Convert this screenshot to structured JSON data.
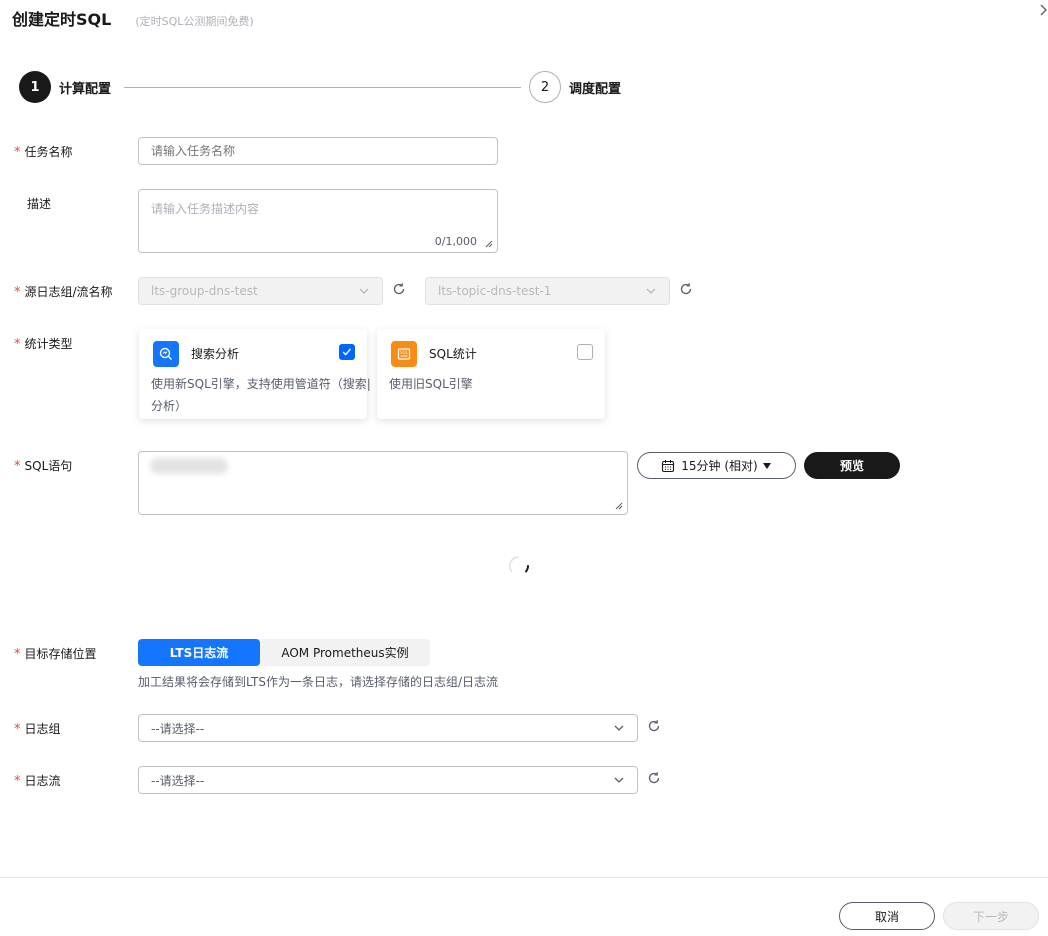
{
  "header": {
    "title": "创建定时SQL",
    "subtitle": "(定时SQL公测期间免费)"
  },
  "steps": [
    {
      "number": "1",
      "label": "计算配置",
      "active": true
    },
    {
      "number": "2",
      "label": "调度配置",
      "active": false
    }
  ],
  "form": {
    "task_name": {
      "label": "任务名称",
      "placeholder": "请输入任务名称",
      "value": ""
    },
    "description": {
      "label": "描述",
      "placeholder": "请输入任务描述内容",
      "counter": "0/1,000"
    },
    "source": {
      "label": "源日志组/流名称",
      "group_value": "lts-group-dns-test",
      "stream_value": "lts-topic-dns-test-1"
    },
    "stat_type": {
      "label": "统计类型",
      "options": [
        {
          "icon": "search-analysis-icon",
          "title": "搜索分析",
          "desc": "使用新SQL引擎，支持使用管道符（搜索|分析）",
          "checked": true,
          "icon_color": "#1476ff"
        },
        {
          "icon": "sql-stat-icon",
          "title": "SQL统计",
          "desc": "使用旧SQL引擎",
          "checked": false,
          "icon_color": "#fa8c16"
        }
      ]
    },
    "sql": {
      "label": "SQL语句",
      "time_range": "15分钟 (相对)",
      "preview_label": "预览"
    },
    "target": {
      "label": "目标存储位置",
      "tabs": [
        "LTS日志流",
        "AOM Prometheus实例"
      ],
      "active_tab": 0,
      "hint": "加工结果将会存储到LTS作为一条日志，请选择存储的日志组/日志流"
    },
    "log_group": {
      "label": "日志组",
      "placeholder": "--请选择--"
    },
    "log_stream": {
      "label": "日志流",
      "placeholder": "--请选择--"
    }
  },
  "footer": {
    "cancel_label": "取消",
    "next_label": "下一步"
  },
  "colors": {
    "required": "#e54545",
    "primary": "#1476ff",
    "dark": "#191919"
  }
}
